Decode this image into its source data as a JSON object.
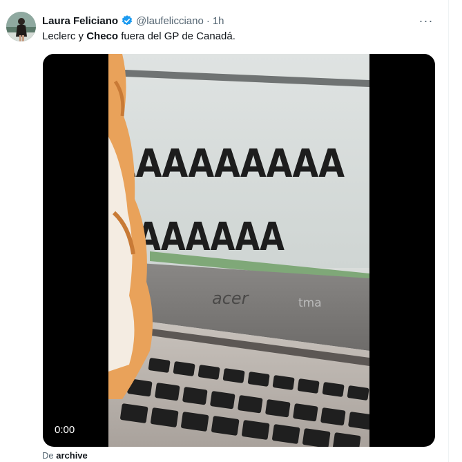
{
  "tweet": {
    "author_name": "Laura Feliciano",
    "handle": "@laufelicciano",
    "separator": "·",
    "time": "1h",
    "text_part1": "Leclerc y ",
    "text_bold": "Checo",
    "text_part2": " fuera del GP de Canadá.",
    "more_label": "···"
  },
  "video": {
    "timestamp": "0:00",
    "screen_line1": "AAAAAAAAA",
    "screen_line2": "AAAAAA",
    "brand_left": "acer",
    "brand_right": "tma"
  },
  "footer": {
    "prefix": "De ",
    "source": "archive"
  },
  "colors": {
    "verified": "#1d9bf0",
    "secondary_text": "#536471",
    "primary_text": "#0f1419"
  }
}
